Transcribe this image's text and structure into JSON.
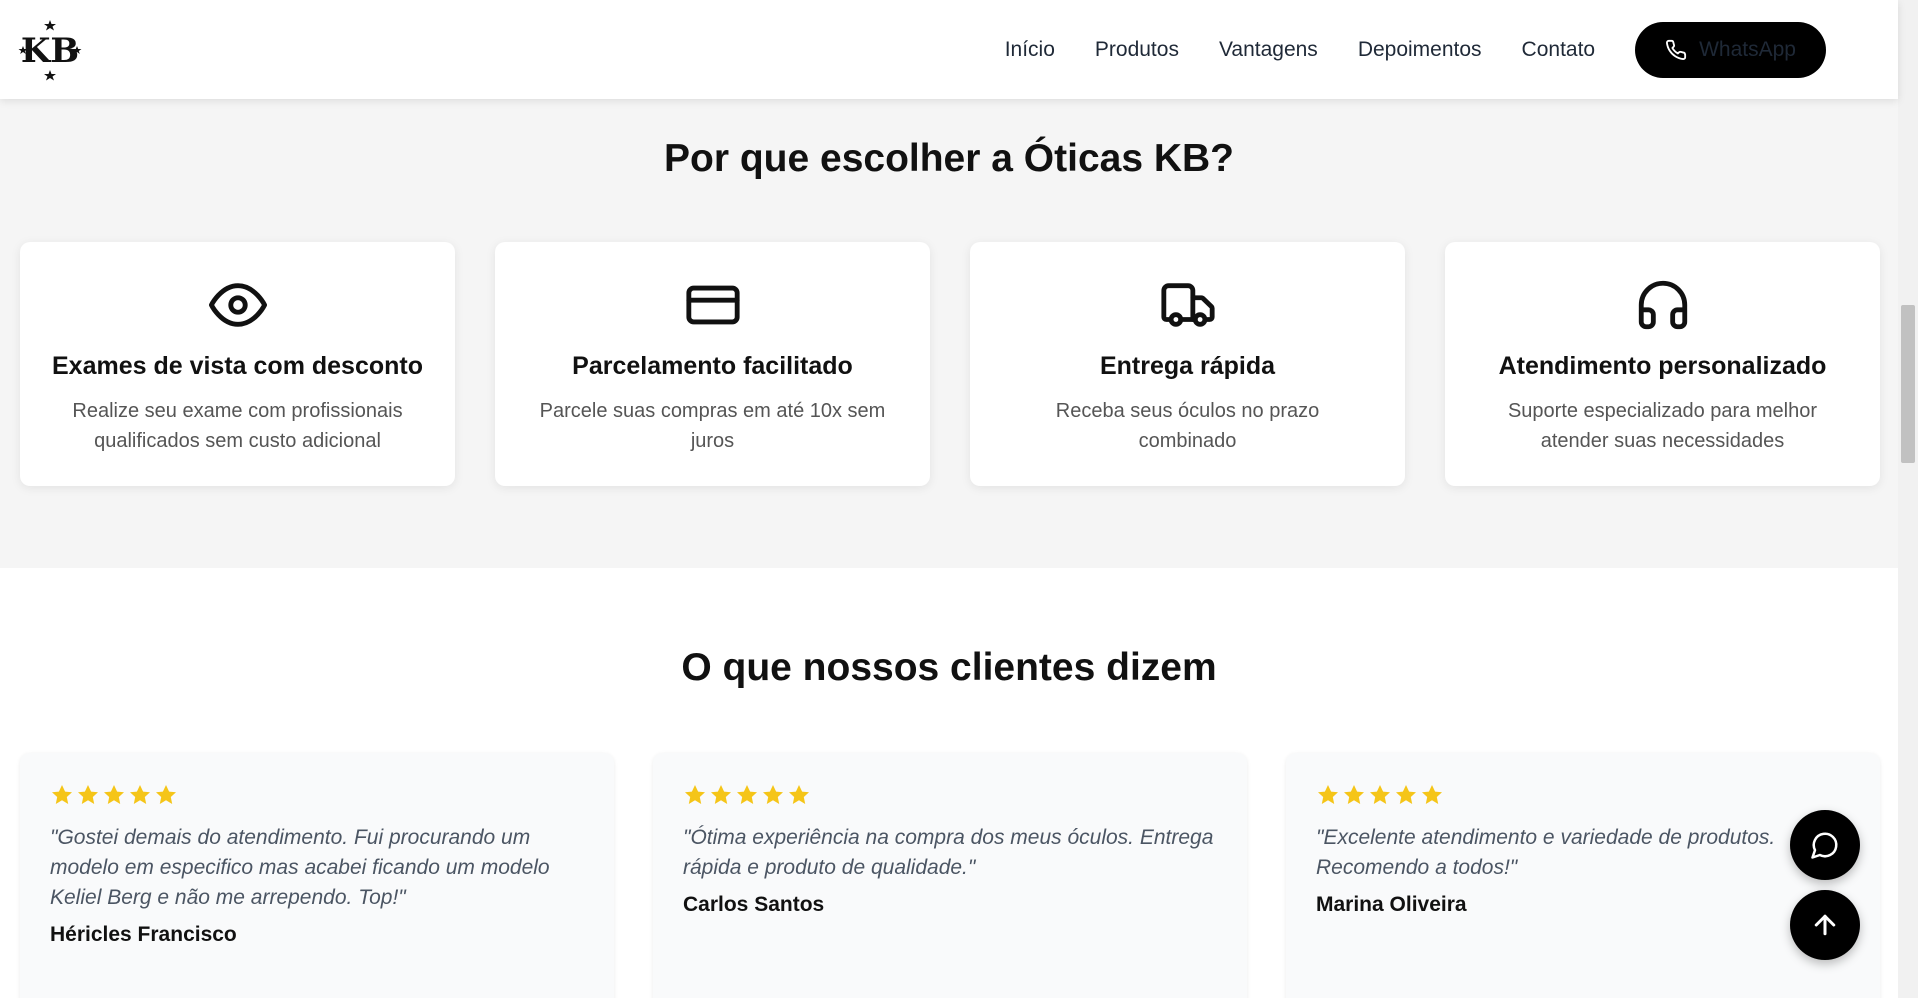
{
  "header": {
    "logo_text": "KB",
    "nav": [
      "Início",
      "Produtos",
      "Vantagens",
      "Depoimentos",
      "Contato"
    ],
    "whatsapp_label": "WhatsApp"
  },
  "why": {
    "title": "Por que escolher a Óticas KB?",
    "features": [
      {
        "icon": "eye-icon",
        "title": "Exames de vista com desconto",
        "text": "Realize seu exame com profissionais qualificados sem custo adicional"
      },
      {
        "icon": "credit-card-icon",
        "title": "Parcelamento facilitado",
        "text": "Parcele suas compras em até 10x sem juros"
      },
      {
        "icon": "truck-icon",
        "title": "Entrega rápida",
        "text": "Receba seus óculos no prazo combinado"
      },
      {
        "icon": "headphones-icon",
        "title": "Atendimento personalizado",
        "text": "Suporte especializado para melhor atender suas necessidades"
      }
    ]
  },
  "testimonials": {
    "title": "O que nossos clientes dizem",
    "items": [
      {
        "rating": 5,
        "quote": "\"Gostei demais do atendimento. Fui procurando um modelo em especifico mas acabei ficando um modelo Keliel Berg e não me arrependo. Top!\"",
        "author": "Héricles Francisco"
      },
      {
        "rating": 5,
        "quote": "\"Ótima experiência na compra dos meus óculos. Entrega rápida e produto de qualidade.\"",
        "author": "Carlos Santos"
      },
      {
        "rating": 5,
        "quote": "\"Excelente atendimento e variedade de produtos. Recomendo a todos!\"",
        "author": "Marina Oliveira"
      }
    ]
  },
  "colors": {
    "star": "#f5c518",
    "button_bg": "#000000",
    "section_bg": "#f5f5f5"
  },
  "floating": {
    "chat_icon": "message-circle-icon",
    "top_icon": "arrow-up-icon"
  }
}
